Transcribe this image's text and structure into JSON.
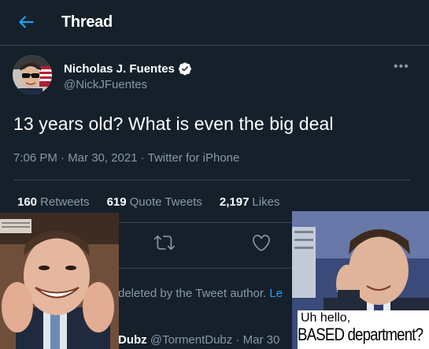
{
  "header": {
    "title": "Thread"
  },
  "tweet": {
    "author_name": "Nicholas J. Fuentes",
    "author_handle": "@NickJFuentes",
    "text": "13 years old? What is even the big deal",
    "meta": "7:06 PM · Mar 30, 2021 · Twitter for iPhone",
    "stats": [
      {
        "count": "160",
        "label": "Retweets"
      },
      {
        "count": "619",
        "label": "Quote Tweets"
      },
      {
        "count": "2,197",
        "label": "Likes"
      }
    ]
  },
  "reply": {
    "deleted_text": "deleted by the Tweet author.",
    "learn_more": "Le",
    "author_name": "Dubz",
    "author_handle": "@TormentDubz",
    "date": "· Mar 30"
  },
  "meme": {
    "caption_line1": "Uh hello,",
    "caption_line2": "BASED department?"
  },
  "colors": {
    "background": "#15202b",
    "accent": "#1da1f2",
    "secondary_text": "#8899a6",
    "border": "#38444d"
  }
}
